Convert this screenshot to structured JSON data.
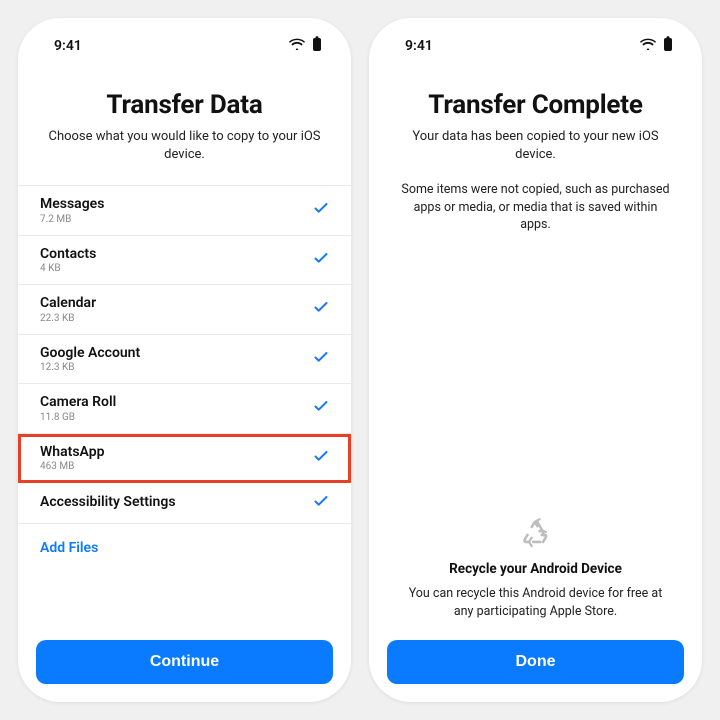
{
  "status": {
    "time": "9:41"
  },
  "phone1": {
    "title": "Transfer Data",
    "subtitle": "Choose what you would like to copy to your iOS device.",
    "items": [
      {
        "name": "Messages",
        "size": "7.2 MB"
      },
      {
        "name": "Contacts",
        "size": "4 KB"
      },
      {
        "name": "Calendar",
        "size": "22.3 KB"
      },
      {
        "name": "Google Account",
        "size": "12.3 KB"
      },
      {
        "name": "Camera Roll",
        "size": "11.8 GB"
      },
      {
        "name": "WhatsApp",
        "size": "463 MB"
      },
      {
        "name": "Accessibility Settings",
        "size": ""
      }
    ],
    "add_files": "Add Files",
    "button": "Continue",
    "highlight_index": 5
  },
  "phone2": {
    "title": "Transfer Complete",
    "subtitle": "Your data has been copied to your new iOS device.",
    "note": "Some items were not copied, such as purchased apps or media, or media that is saved within apps.",
    "recycle_title": "Recycle your Android Device",
    "recycle_text": "You can recycle this Android device for free at any participating Apple Store.",
    "button": "Done"
  }
}
